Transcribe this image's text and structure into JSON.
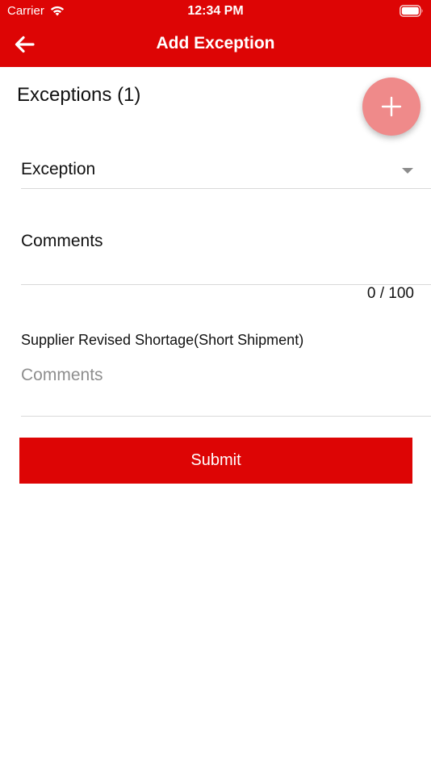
{
  "status_bar": {
    "carrier": "Carrier",
    "time": "12:34 PM",
    "icons": [
      "wifi-icon",
      "battery-icon"
    ]
  },
  "nav": {
    "title": "Add Exception",
    "back_icon": "arrow-left-icon"
  },
  "exceptions": {
    "title": "Exceptions (1)",
    "add_icon": "plus-icon"
  },
  "form": {
    "exception_dropdown": {
      "label": "Exception",
      "icon": "caret-down-icon"
    },
    "comments": {
      "placeholder": "Comments",
      "value": "",
      "counter": "0 / 100"
    },
    "supplier": {
      "label": "Supplier Revised Shortage(Short Shipment)",
      "placeholder": "Comments",
      "value": ""
    },
    "submit_label": "Submit"
  },
  "colors": {
    "primary": "#dd0505",
    "fab": "#ef8a8a",
    "divider": "#d9d9d9",
    "placeholder": "#8e8e8e"
  }
}
